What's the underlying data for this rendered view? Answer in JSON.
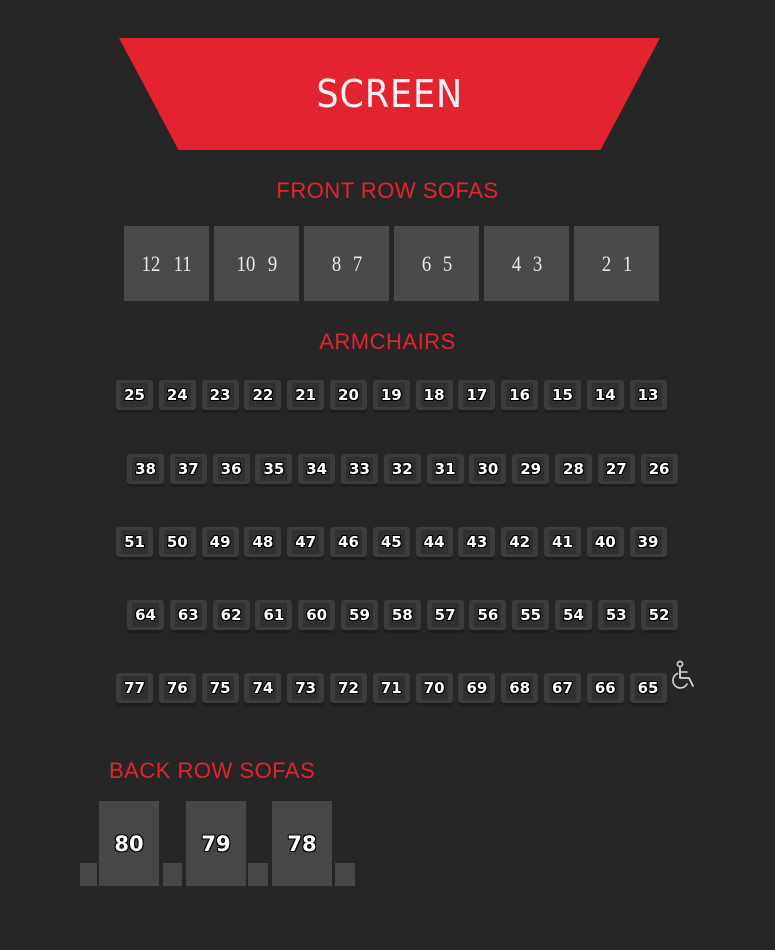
{
  "screen": {
    "label": "SCREEN"
  },
  "sections": {
    "front": "FRONT ROW SOFAS",
    "armchairs": "ARMCHAIRS",
    "back": "BACK ROW SOFAS"
  },
  "front_sofas": [
    {
      "left": "12",
      "right": "11"
    },
    {
      "left": "10",
      "right": "9"
    },
    {
      "left": "8",
      "right": "7"
    },
    {
      "left": "6",
      "right": "5"
    },
    {
      "left": "4",
      "right": "3"
    },
    {
      "left": "2",
      "right": "1"
    }
  ],
  "armchair_rows": [
    [
      "25",
      "24",
      "23",
      "22",
      "21",
      "20",
      "19",
      "18",
      "17",
      "16",
      "15",
      "14",
      "13"
    ],
    [
      "38",
      "37",
      "36",
      "35",
      "34",
      "33",
      "32",
      "31",
      "30",
      "29",
      "28",
      "27",
      "26"
    ],
    [
      "51",
      "50",
      "49",
      "48",
      "47",
      "46",
      "45",
      "44",
      "43",
      "42",
      "41",
      "40",
      "39"
    ],
    [
      "64",
      "63",
      "62",
      "61",
      "60",
      "59",
      "58",
      "57",
      "56",
      "55",
      "54",
      "53",
      "52"
    ],
    [
      "77",
      "76",
      "75",
      "74",
      "73",
      "72",
      "71",
      "70",
      "69",
      "68",
      "67",
      "66",
      "65"
    ]
  ],
  "back_sofas": [
    "80",
    "79",
    "78"
  ],
  "icons": {
    "accessibility": "wheelchair-icon"
  },
  "colors": {
    "accent": "#e3232f",
    "background": "#262626",
    "sofa": "#4a4a4a"
  }
}
